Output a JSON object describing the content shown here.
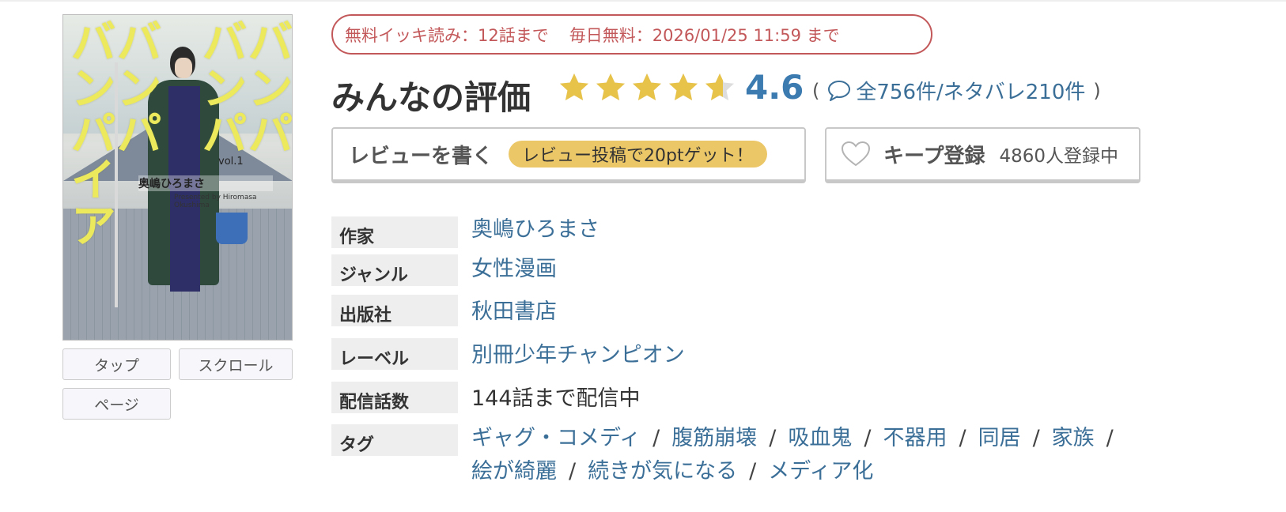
{
  "cover": {
    "title_columns": [
      "バンパ",
      "バンパ",
      "バンパ",
      "バンパイア"
    ],
    "author": "奥嶋ひろまさ",
    "volume": "vol.1",
    "presented": "Presented by Hiromasa Okushima"
  },
  "view_modes": [
    "タップ",
    "スクロール",
    "ページ"
  ],
  "free_notice": {
    "ikki": "無料イッキ読み：12話まで",
    "daily": "毎日無料：2026/01/25 11:59 まで"
  },
  "rating": {
    "heading": "みんなの評価",
    "score": "4.6",
    "stars": 4.6,
    "star_color": "#e8c34a",
    "open_paren": "(",
    "reviews": "全756件/ネタバレ210件",
    "close_paren": ")"
  },
  "actions": {
    "write_review": "レビューを書く",
    "review_bonus": "レビュー投稿で20ptゲット！",
    "keep": "キープ登録",
    "keep_count": "4860人登録中"
  },
  "info": [
    {
      "label": "作家",
      "value": "奥嶋ひろまさ"
    },
    {
      "label": "ジャンル",
      "value": "女性漫画"
    },
    {
      "label": "出版社",
      "value": "秋田書店"
    },
    {
      "label": "レーベル",
      "value": "別冊少年チャンピオン"
    },
    {
      "label": "配信話数",
      "value": "144話まで配信中"
    },
    {
      "label": "タグ",
      "value": ""
    }
  ],
  "tags": [
    "ギャグ・コメディ",
    "腹筋崩壊",
    "吸血鬼",
    "不器用",
    "同居",
    "家族",
    "絵が綺麗",
    "続きが気になる",
    "メディア化"
  ],
  "tag_separator": "/",
  "icons": {
    "star": "star-icon",
    "comment": "speech-bubble-icon",
    "keep": "heart-icon"
  }
}
